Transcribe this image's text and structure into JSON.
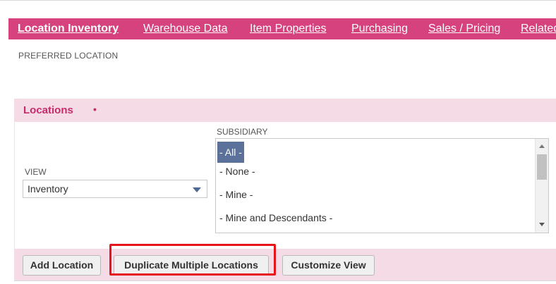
{
  "tabs": [
    {
      "label": "Location Inventory",
      "active": true
    },
    {
      "label": "Warehouse Data",
      "active": false
    },
    {
      "label": "Item Properties",
      "active": false
    },
    {
      "label": "Purchasing",
      "active": false
    },
    {
      "label": "Sales / Pricing",
      "active": false
    },
    {
      "label": "Related",
      "active": false
    }
  ],
  "preferred_location_label": "PREFERRED LOCATION",
  "locations": {
    "title": "Locations",
    "required_marker": "•",
    "view_label": "VIEW",
    "view_value": "Inventory",
    "subsidiary_label": "SUBSIDIARY",
    "subsidiary_options": [
      {
        "label": "- All -",
        "selected": true
      },
      {
        "label": "- None -",
        "selected": false
      },
      {
        "label": "- Mine -",
        "selected": false
      },
      {
        "label": "- Mine and Descendants -",
        "selected": false
      }
    ]
  },
  "buttons": {
    "add_location": "Add Location",
    "duplicate_multiple_locations": "Duplicate Multiple Locations",
    "customize_view": "Customize View"
  },
  "colors": {
    "tab_bar": "#d5427e",
    "section_bg": "#f5dbe6",
    "section_title": "#c62b6c",
    "selected_option": "#5b7199",
    "highlight_box": "#e8141b"
  },
  "highlighted_element": "duplicate_multiple_locations"
}
